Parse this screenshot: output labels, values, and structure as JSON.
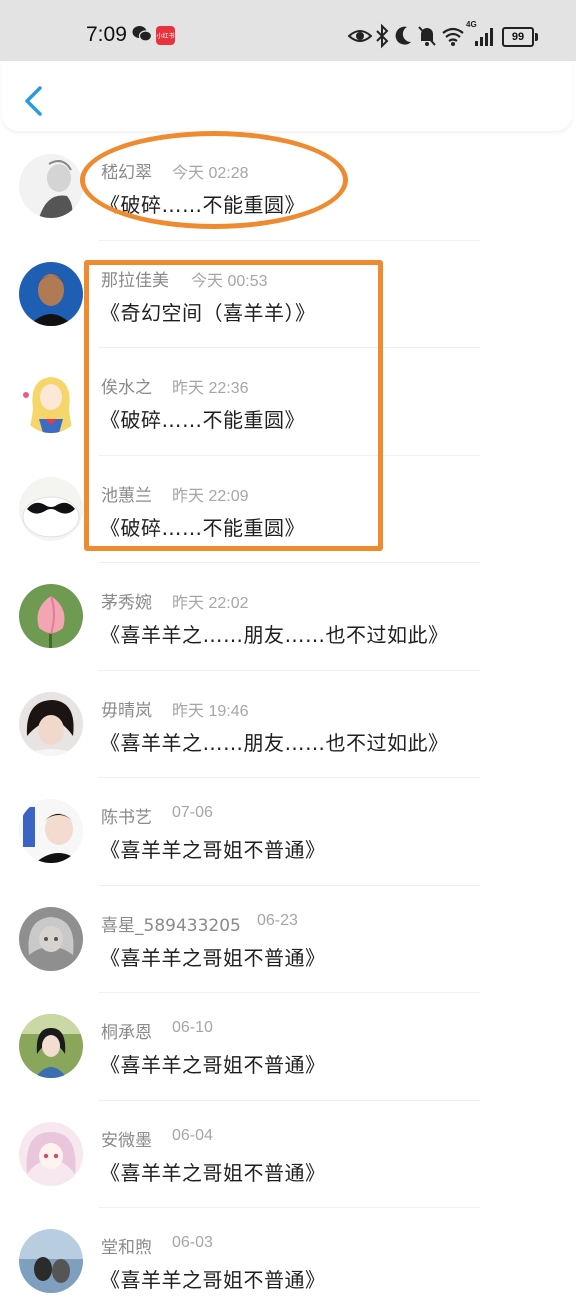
{
  "status_bar": {
    "time": "7:09",
    "app_badge": "小红书",
    "battery": "99",
    "network_label": "4G",
    "icons": [
      "wechat-icon",
      "eye-icon",
      "bluetooth-icon",
      "moon-icon",
      "bell-off-icon",
      "wifi-icon",
      "signal-icon",
      "battery-icon"
    ]
  },
  "nav": {
    "back_icon": "chevron-left-icon",
    "accent_color": "#2a9be0"
  },
  "annotations": {
    "color": "#f08a2e",
    "shapes": [
      "ellipse",
      "rectangle"
    ]
  },
  "comments": [
    {
      "name": "嵇幻翠",
      "time": "今天 02:28",
      "message": "《破碎……不能重圆》",
      "avatar": "avatar-sketch"
    },
    {
      "name": "那拉佳美",
      "time": "今天 00:53",
      "message": "《奇幻空间（喜羊羊）》",
      "avatar": "avatar-boy-blue"
    },
    {
      "name": "俟水之",
      "time": "昨天 22:36",
      "message": "《破碎……不能重圆》",
      "avatar": "avatar-anime-girl"
    },
    {
      "name": "池蕙兰",
      "time": "昨天 22:09",
      "message": "《破碎……不能重圆》",
      "avatar": "avatar-mustache"
    },
    {
      "name": "茅秀婉",
      "time": "昨天 22:02",
      "message": "《喜羊羊之……朋友……也不过如此》",
      "avatar": "avatar-lotus"
    },
    {
      "name": "毋晴岚",
      "time": "昨天 19:46",
      "message": "《喜羊羊之……朋友……也不过如此》",
      "avatar": "avatar-girl-dark"
    },
    {
      "name": "陈书艺",
      "time": "07-06",
      "message": "《喜羊羊之哥姐不普通》",
      "avatar": "avatar-boy-white"
    },
    {
      "name": "喜星_589433205",
      "time": "06-23",
      "message": "《喜羊羊之哥姐不普通》",
      "avatar": "avatar-grey-anime"
    },
    {
      "name": "桐承恩",
      "time": "06-10",
      "message": "《喜羊羊之哥姐不普通》",
      "avatar": "avatar-girl-trees"
    },
    {
      "name": "安微墨",
      "time": "06-04",
      "message": "《喜羊羊之哥姐不普通》",
      "avatar": "avatar-pink-anime"
    },
    {
      "name": "堂和煦",
      "time": "06-03",
      "message": "《喜羊羊之哥姐不普通》",
      "avatar": "avatar-couple-sea"
    }
  ]
}
